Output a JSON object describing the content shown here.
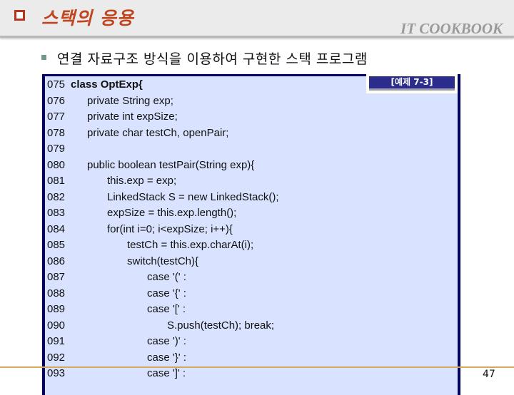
{
  "header": {
    "title": "스택의 응용",
    "brand": "IT COOKBOOK"
  },
  "subtitle": "연결 자료구조 방식을 이용하여 구현한 스택 프로그램",
  "example_label": "[예제 7-3]",
  "code_lines": [
    {
      "num": "075",
      "indent": 0,
      "text": "class OptExp{",
      "bold": true
    },
    {
      "num": "076",
      "indent": 1,
      "text": "private String exp;"
    },
    {
      "num": "077",
      "indent": 1,
      "text": "private int expSize;"
    },
    {
      "num": "078",
      "indent": 1,
      "text": "private char testCh, openPair;"
    },
    {
      "num": "079",
      "indent": 0,
      "text": ""
    },
    {
      "num": "080",
      "indent": 1,
      "text": "public boolean testPair(String exp){"
    },
    {
      "num": "081",
      "indent": 2,
      "text": "this.exp = exp;"
    },
    {
      "num": "082",
      "indent": 2,
      "text": "LinkedStack S = new LinkedStack();"
    },
    {
      "num": "083",
      "indent": 2,
      "text": "expSize = this.exp.length();"
    },
    {
      "num": "084",
      "indent": 2,
      "text": "for(int i=0; i<expSize; i++){"
    },
    {
      "num": "085",
      "indent": 3,
      "text": "testCh = this.exp.charAt(i);"
    },
    {
      "num": "086",
      "indent": 3,
      "text": "switch(testCh){"
    },
    {
      "num": "087",
      "indent": 4,
      "text": "case '(' :"
    },
    {
      "num": "088",
      "indent": 4,
      "text": "case '{' :"
    },
    {
      "num": "089",
      "indent": 4,
      "text": "case '[' :"
    },
    {
      "num": "090",
      "indent": 5,
      "text": "S.push(testCh); break;"
    },
    {
      "num": "091",
      "indent": 4,
      "text": "case ')' :"
    },
    {
      "num": "092",
      "indent": 4,
      "text": "case '}' :"
    },
    {
      "num": "093",
      "indent": 4,
      "text": "case ']' :"
    }
  ],
  "page_number": "47",
  "colors": {
    "title": "#c0441e",
    "code_bg": "#d9e3ff",
    "code_border": "#000066",
    "label_bg": "#2c2c8c",
    "footer_line": "#d4a95c"
  }
}
